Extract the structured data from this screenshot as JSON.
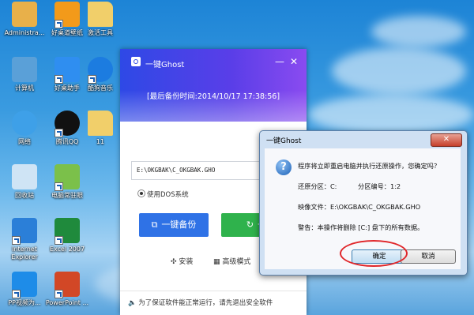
{
  "desktop": {
    "icons": [
      {
        "label": "Administra...",
        "icon": "user-folder-icon",
        "color": "#e8b04a"
      },
      {
        "label": "好桌道壁纸",
        "icon": "wallpaper-icon",
        "color": "#f39a1a"
      },
      {
        "label": "激活工具",
        "icon": "folder-icon",
        "color": "#f1cf6a"
      },
      {
        "label": "计算机",
        "icon": "computer-icon",
        "color": "#5aa0d8"
      },
      {
        "label": "好桌助手",
        "icon": "assistant-icon",
        "color": "#2f8ef0"
      },
      {
        "label": "酷狗音乐",
        "icon": "kugou-icon",
        "color": "#1c7ce0"
      },
      {
        "label": "网络",
        "icon": "network-icon",
        "color": "#3ea0e8"
      },
      {
        "label": "腾讯QQ",
        "icon": "qq-icon",
        "color": "#111111"
      },
      {
        "label": "11",
        "icon": "folder-icon",
        "color": "#f1cf6a"
      },
      {
        "label": "回收站",
        "icon": "recycle-bin-icon",
        "color": "#cfe4f5"
      },
      {
        "label": "电脑常驻眼",
        "icon": "app-icon",
        "color": "#7bc04a"
      },
      {
        "label": "Internet Explorer",
        "icon": "ie-icon",
        "color": "#2b7fd8"
      },
      {
        "label": "Excel 2007",
        "icon": "excel-icon",
        "color": "#1f8a3c"
      },
      {
        "label": "PP视频为...",
        "icon": "pptv-icon",
        "color": "#1e8ce8"
      },
      {
        "label": "PowerPoint ...",
        "icon": "powerpoint-icon",
        "color": "#d24726"
      }
    ]
  },
  "ghost_window": {
    "title": "一键Ghost",
    "minimize": "—",
    "close": "✕",
    "last_backup": "[最后备份时间:2014/10/17 17:38:56]",
    "path_value": "E:\\OKGBAK\\C_OKGBAK.GHO",
    "radio_label": "使用DOS系统",
    "backup_button": "一键备份",
    "restore_button": "一键",
    "install_label": "安装",
    "advanced_label": "高级模式",
    "tip": "为了保证软件能正常运行，请先退出安全软件",
    "colors": {
      "header_start": "#2e49e6",
      "header_end": "#8a4bf0",
      "backup": "#2f72e6",
      "restore": "#2fb24c"
    }
  },
  "dialog": {
    "title": "一键Ghost",
    "close": "✕",
    "question": "程序将立即重启电脑并执行还原操作，您确定吗？",
    "restore_partition": "还原分区：C:",
    "partition_number": "分区编号：1:2",
    "image_file": "映像文件：E:\\OKGBAK\\C_OKGBAK.GHO",
    "warning": "警告：本操作将删除 [C:] 盘下的所有数据。",
    "ok_button": "确定",
    "cancel_button": "取消",
    "highlight_color": "#e0262a"
  }
}
